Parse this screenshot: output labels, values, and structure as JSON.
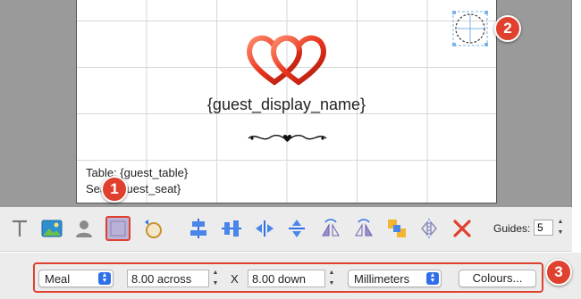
{
  "canvas": {
    "guest_display_name": "{guest_display_name}",
    "table_text": "Table: {guest_table}",
    "seat_text": "Seat: {guest_seat}"
  },
  "callouts": {
    "one": "1",
    "two": "2",
    "three": "3"
  },
  "toolbar": {
    "tools": [
      {
        "name": "text-tool-icon"
      },
      {
        "name": "image-tool-icon"
      },
      {
        "name": "person-tool-icon"
      },
      {
        "name": "rectangle-tool-icon"
      },
      {
        "name": "circle-tool-icon"
      },
      {
        "name": "align-horizontal-icon"
      },
      {
        "name": "align-vertical-icon"
      },
      {
        "name": "distribute-horizontal-icon"
      },
      {
        "name": "distribute-vertical-icon"
      },
      {
        "name": "flip-horizontal-icon"
      },
      {
        "name": "flip-vertical-icon"
      },
      {
        "name": "arrange-icon"
      },
      {
        "name": "symmetry-icon"
      },
      {
        "name": "delete-icon"
      }
    ],
    "guides_label": "Guides:",
    "guides_value": "5"
  },
  "bottombar": {
    "layout_select": "Meal",
    "across_value": "8.00 across",
    "x_separator": "X",
    "down_value": "8.00 down",
    "units_select": "Millimeters",
    "colours_button": "Colours..."
  },
  "colors": {
    "accent": "#e0412f",
    "selection": "#b9b2d6",
    "select_arrow": "#2f6fe8",
    "workspace": "#9a9a9a"
  }
}
